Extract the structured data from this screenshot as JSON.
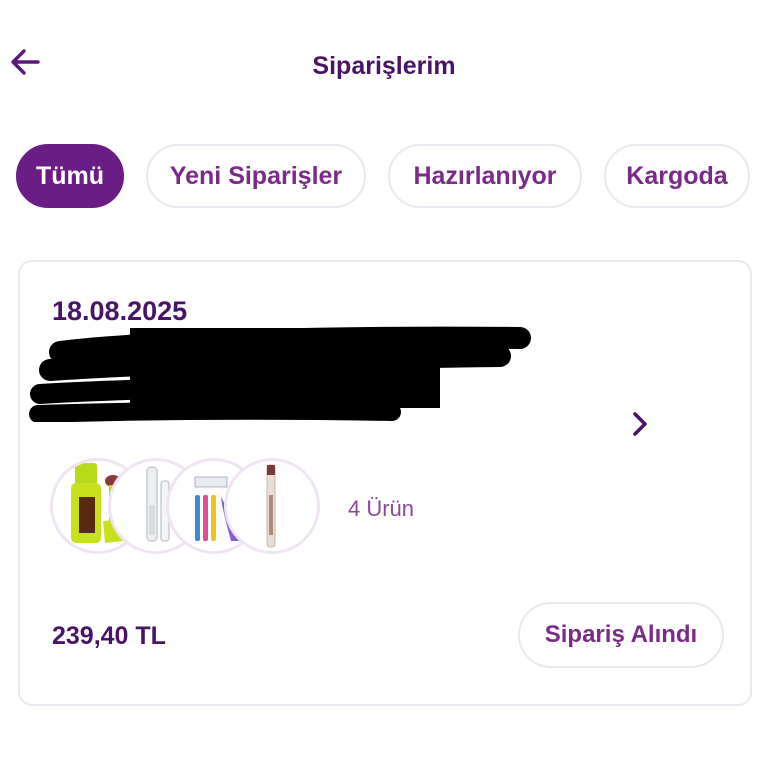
{
  "header": {
    "title": "Siparişlerim",
    "back_icon": "arrow-left-icon"
  },
  "tabs": [
    {
      "label": "Tümü",
      "active": true
    },
    {
      "label": "Yeni Siparişler",
      "active": false
    },
    {
      "label": "Hazırlanıyor",
      "active": false
    },
    {
      "label": "Kargoda",
      "active": false
    }
  ],
  "order": {
    "date": "18.08.2025",
    "item_count_label": "4 Ürün",
    "total": "239,40 TL",
    "status_label": "Sipariş Alındı",
    "thumbnails": [
      "lip-oil-product",
      "mascara-product",
      "brow-razor-set-product",
      "lip-liner-pencil-product"
    ],
    "chevron_icon": "chevron-right-icon"
  },
  "colors": {
    "brand": "#6b1d86",
    "text_dark": "#4a1466",
    "text_accent": "#7a2a88",
    "border": "#ece6ef"
  }
}
